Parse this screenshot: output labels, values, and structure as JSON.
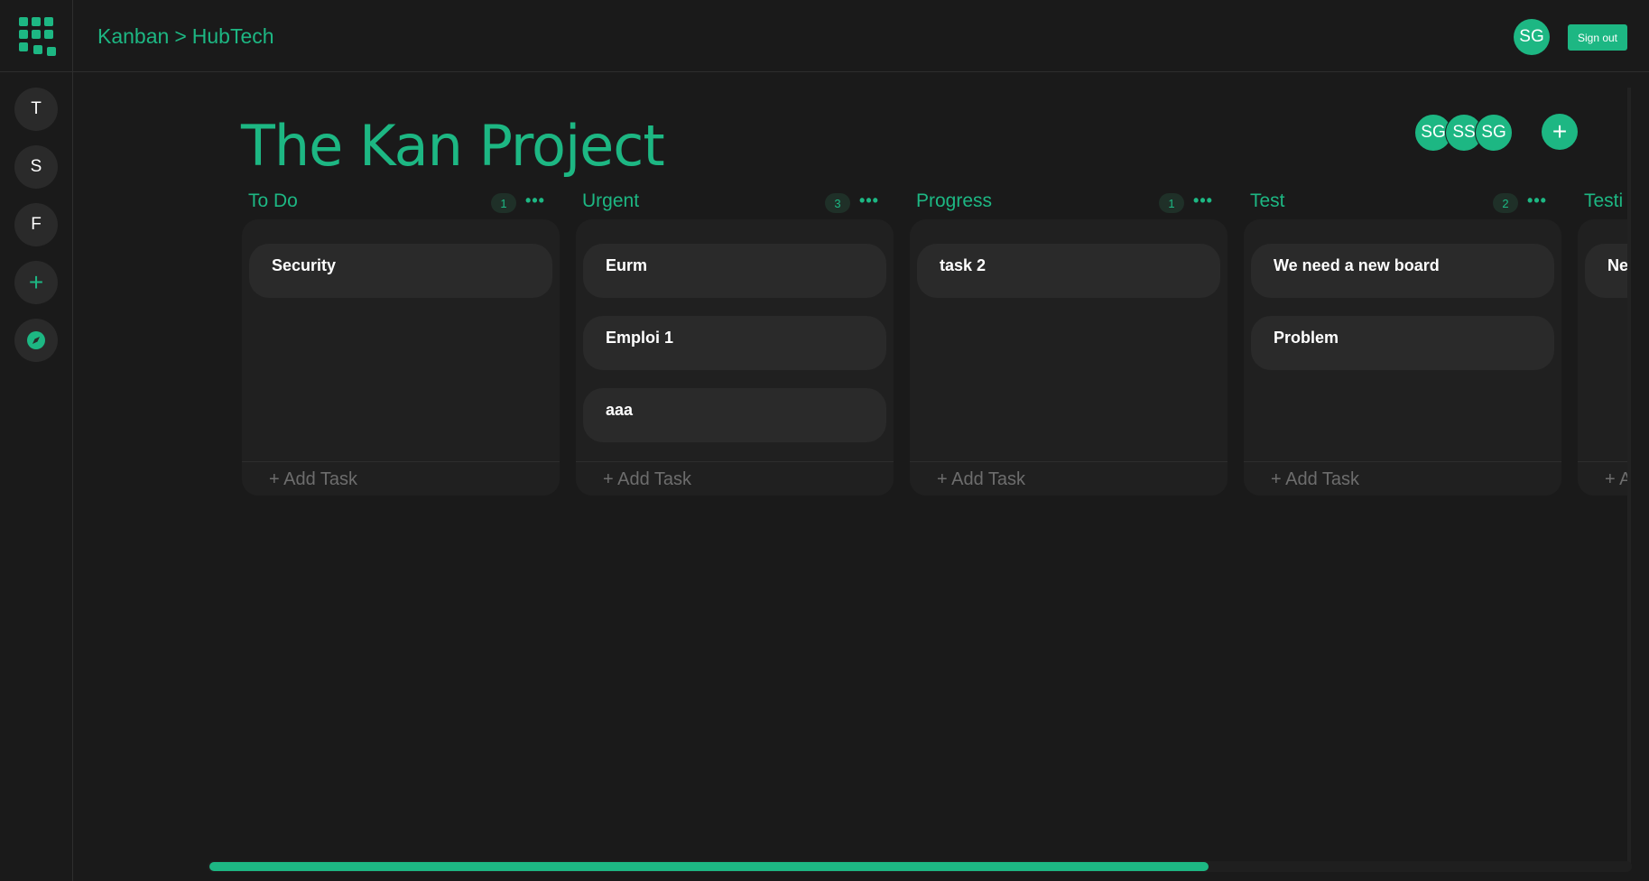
{
  "header": {
    "breadcrumb": [
      "Kanban",
      ">",
      "HubTech"
    ],
    "user_initials": "SG",
    "signout_label": "Sign out"
  },
  "sidebar": {
    "items": [
      {
        "label": "T"
      },
      {
        "label": "S"
      },
      {
        "label": "F"
      },
      {
        "label": "+",
        "icon": "plus-icon"
      },
      {
        "label": "",
        "icon": "compass-icon"
      }
    ]
  },
  "project": {
    "title": "The Kan Project",
    "members": [
      "SG",
      "SS",
      "SG"
    ],
    "add_member_label": "+",
    "owner_marker": "crown-icon"
  },
  "columns": [
    {
      "title": "To Do",
      "count": "1",
      "cards": [
        "Security"
      ],
      "add_label": "+ Add Task"
    },
    {
      "title": "Urgent",
      "count": "3",
      "cards": [
        "Eurm",
        "Emploi 1",
        "aaa"
      ],
      "add_label": "+ Add Task"
    },
    {
      "title": "Progress",
      "count": "1",
      "cards": [
        "task 2"
      ],
      "add_label": "+ Add Task"
    },
    {
      "title": "Test",
      "count": "2",
      "cards": [
        "We need a new board",
        "Problem"
      ],
      "add_label": "+ Add Task"
    },
    {
      "title": "Testi",
      "count": "",
      "cards": [
        "Ne"
      ],
      "add_label": "+ A"
    }
  ],
  "colors": {
    "accent": "#1db783",
    "background": "#1a1a1a",
    "column": "#202020",
    "card": "#2a2a2a"
  }
}
